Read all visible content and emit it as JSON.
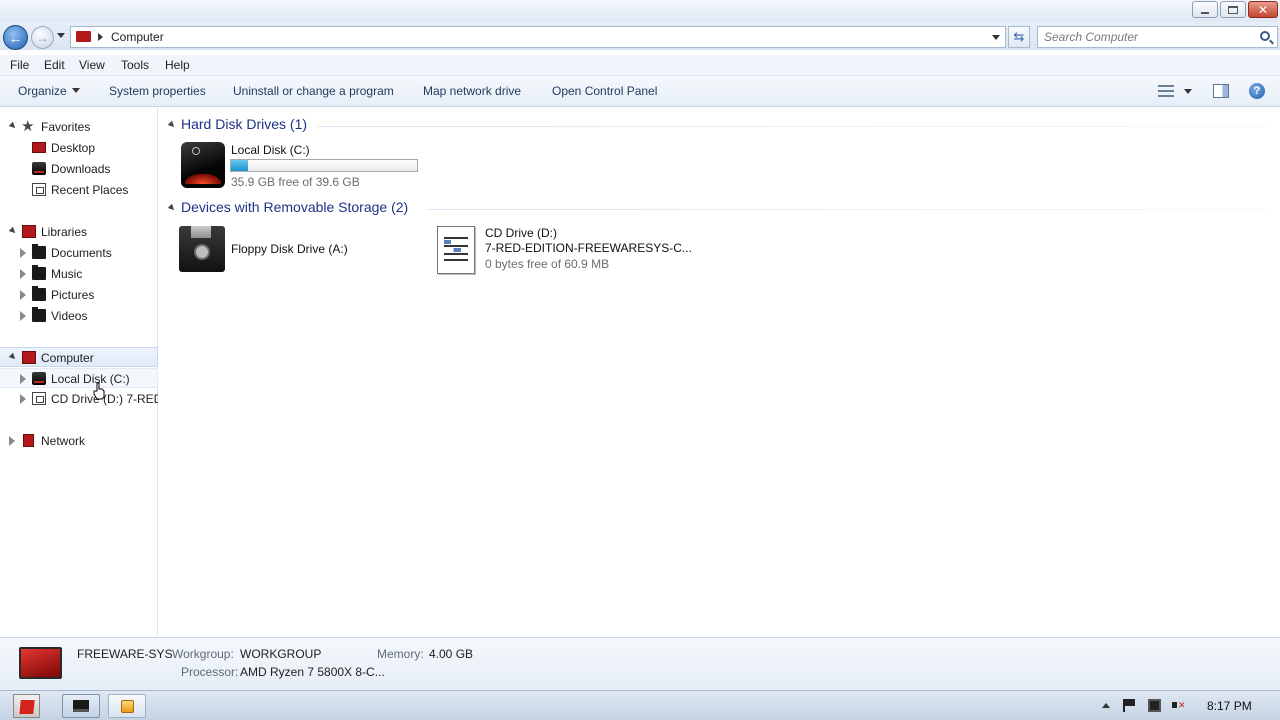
{
  "address_bar": {
    "path_label": "Computer",
    "search_placeholder": "Search Computer"
  },
  "menu": {
    "file": "File",
    "edit": "Edit",
    "view": "View",
    "tools": "Tools",
    "help": "Help"
  },
  "commands": {
    "organize": "Organize",
    "system_properties": "System properties",
    "uninstall": "Uninstall or change a program",
    "map_drive": "Map network drive",
    "control_panel": "Open Control Panel"
  },
  "nav": {
    "favorites": "Favorites",
    "desktop": "Desktop",
    "downloads": "Downloads",
    "recent_places": "Recent Places",
    "libraries": "Libraries",
    "documents": "Documents",
    "music": "Music",
    "pictures": "Pictures",
    "videos": "Videos",
    "computer": "Computer",
    "local_disk": "Local Disk (C:)",
    "cd_drive": "CD Drive (D:) 7-RED-",
    "network": "Network"
  },
  "groups": {
    "hard_disks": "Hard Disk Drives (1)",
    "removable": "Devices with Removable Storage (2)"
  },
  "drives": {
    "local_disk": {
      "name": "Local Disk (C:)",
      "free_text": "35.9 GB free of 39.6 GB",
      "used_fraction": 0.09
    },
    "floppy": {
      "name": "Floppy Disk Drive (A:)"
    },
    "cd": {
      "name": "CD Drive (D:)",
      "label": "7-RED-EDITION-FREEWARESYS-C...",
      "free_text": "0 bytes free of 60.9 MB"
    }
  },
  "details": {
    "computer_name": "FREEWARE-SYS",
    "workgroup_label": "Workgroup:",
    "workgroup_value": "WORKGROUP",
    "memory_label": "Memory:",
    "memory_value": "4.00 GB",
    "processor_label": "Processor:",
    "processor_value": "AMD Ryzen 7 5800X 8-C..."
  },
  "taskbar": {
    "clock": "8:17 PM"
  },
  "colors": {
    "accent_red": "#b3191b",
    "group_title": "#1e3287",
    "meter_fill": "#1a94cf"
  }
}
